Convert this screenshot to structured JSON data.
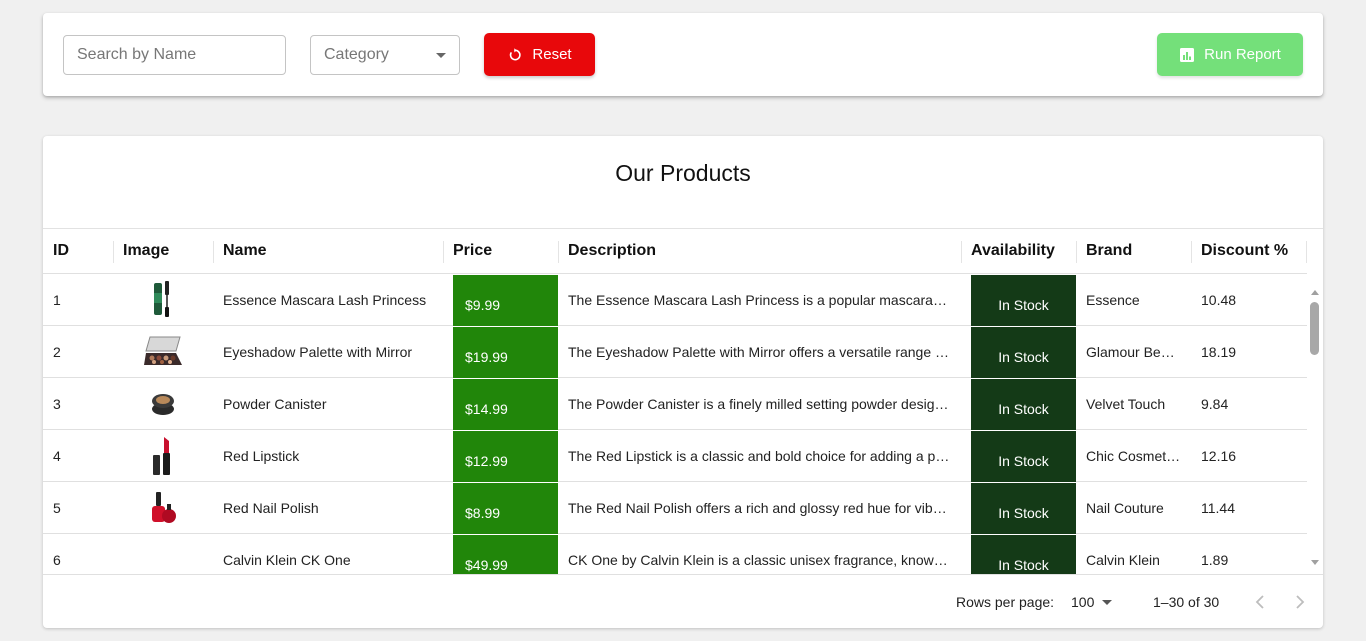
{
  "toolbar": {
    "search_placeholder": "Search by Name",
    "category_placeholder": "Category",
    "reset_label": "Reset",
    "run_report_label": "Run Report"
  },
  "card": {
    "title": "Our Products"
  },
  "table": {
    "columns": [
      "ID",
      "Image",
      "Name",
      "Price",
      "Description",
      "Availability",
      "Brand",
      "Discount %"
    ],
    "rows": [
      {
        "id": "1",
        "image": "mascara-image",
        "name": "Essence Mascara Lash Princess",
        "price": "$9.99",
        "description": "The Essence Mascara Lash Princess is a popular mascara…",
        "availability": "In Stock",
        "brand": "Essence",
        "discount": "10.48"
      },
      {
        "id": "2",
        "image": "eyeshadow-palette-image",
        "name": "Eyeshadow Palette with Mirror",
        "price": "$19.99",
        "description": "The Eyeshadow Palette with Mirror offers a versatile range …",
        "availability": "In Stock",
        "brand": "Glamour Be…",
        "discount": "18.19"
      },
      {
        "id": "3",
        "image": "powder-canister-image",
        "name": "Powder Canister",
        "price": "$14.99",
        "description": "The Powder Canister is a finely milled setting powder desig…",
        "availability": "In Stock",
        "brand": "Velvet Touch",
        "discount": "9.84"
      },
      {
        "id": "4",
        "image": "lipstick-image",
        "name": "Red Lipstick",
        "price": "$12.99",
        "description": "The Red Lipstick is a classic and bold choice for adding a p…",
        "availability": "In Stock",
        "brand": "Chic Cosmet…",
        "discount": "12.16"
      },
      {
        "id": "5",
        "image": "nail-polish-image",
        "name": "Red Nail Polish",
        "price": "$8.99",
        "description": "The Red Nail Polish offers a rich and glossy red hue for vib…",
        "availability": "In Stock",
        "brand": "Nail Couture",
        "discount": "11.44"
      },
      {
        "id": "6",
        "image": "",
        "name": "Calvin Klein CK One",
        "price": "$49.99",
        "description": "CK One by Calvin Klein is a classic unisex fragrance, know…",
        "availability": "In Stock",
        "brand": "Calvin Klein",
        "discount": "1.89"
      }
    ]
  },
  "pagination": {
    "rows_per_page_label": "Rows per page:",
    "rows_per_page_value": "100",
    "range_text": "1–30 of 30"
  },
  "colors": {
    "reset_button": "#e8080b",
    "run_report_button": "#74e07a",
    "price_cell": "#21860a",
    "availability_cell": "#143a17"
  }
}
